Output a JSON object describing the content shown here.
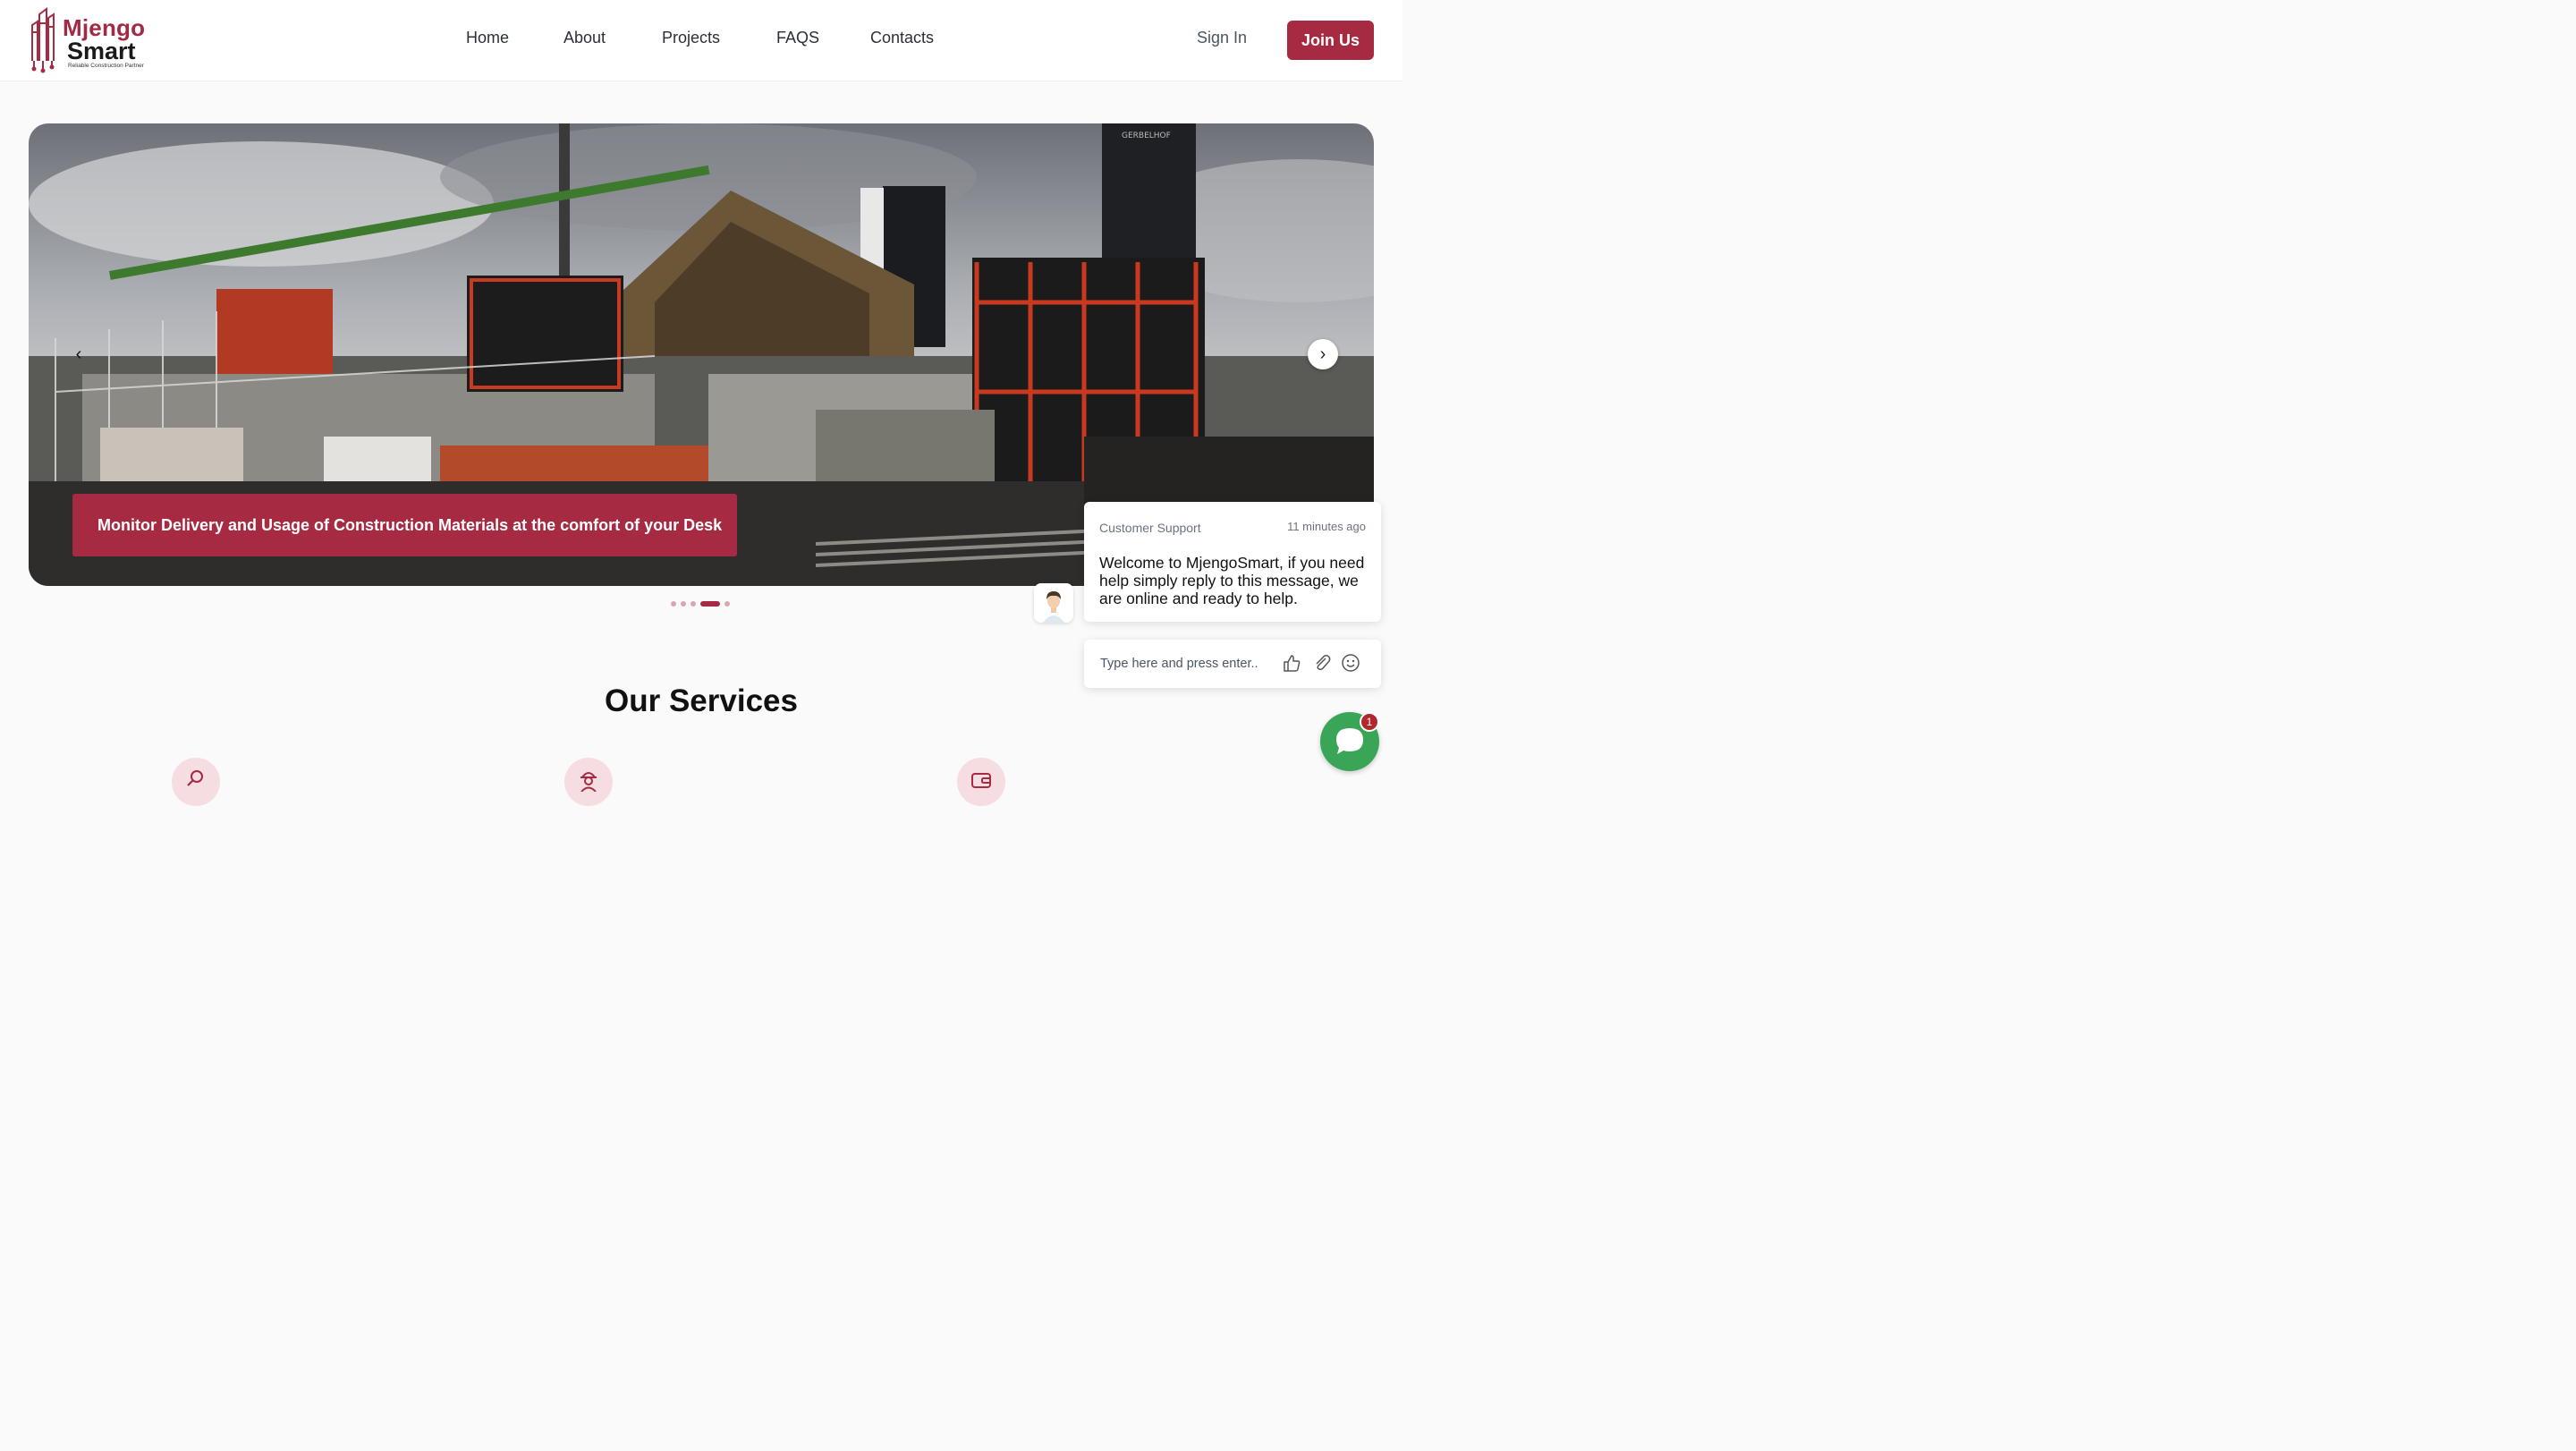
{
  "brand": {
    "name_line1": "Mjengo",
    "name_line2": "Smart",
    "tagline": "Reliable Construction Partner"
  },
  "nav": {
    "items": [
      {
        "label": "Home"
      },
      {
        "label": "About"
      },
      {
        "label": "Projects"
      },
      {
        "label": "FAQS"
      },
      {
        "label": "Contacts"
      }
    ],
    "sign_in": "Sign In",
    "join": "Join Us"
  },
  "hero": {
    "caption": "Monitor Delivery and Usage of Construction Materials at the comfort of your Desk",
    "prev_glyph": "‹",
    "next_glyph": "›",
    "slide_count": 5,
    "active_slide_index": 3,
    "image_text": "GERBELHOF"
  },
  "services": {
    "title": "Our Services",
    "icons": [
      "search-document-icon",
      "worker-icon",
      "wallet-icon"
    ]
  },
  "chat": {
    "sender": "Customer Support",
    "time": "11 minutes ago",
    "message": "Welcome to MjengoSmart, if you need help simply reply to this message, we are online and ready to help.",
    "input_placeholder": "Type here and press enter..",
    "unread_count": "1"
  },
  "colors": {
    "brand": "#a62b42",
    "chat_green": "#3aa556",
    "badge_red": "#b1272e"
  }
}
